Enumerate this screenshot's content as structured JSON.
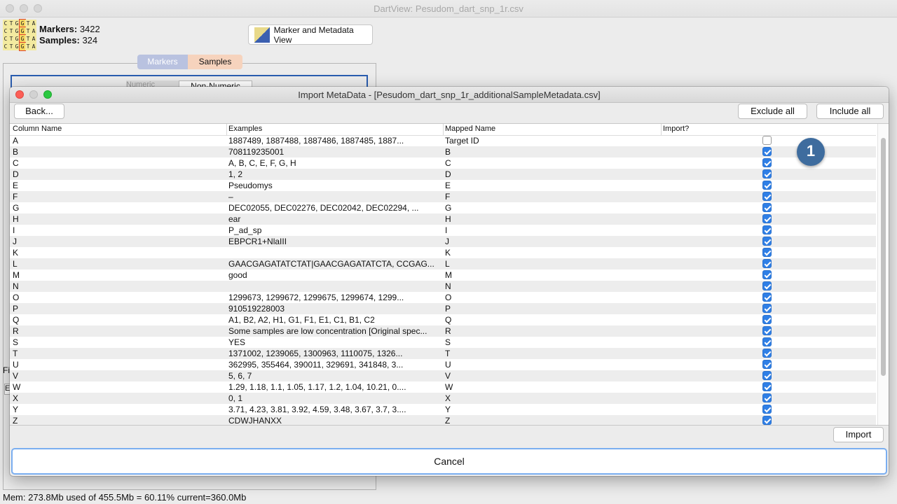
{
  "main_window": {
    "title": "DartView: Pesudom_dart_snp_1r.csv",
    "logo_letters": [
      "C",
      "T",
      "G",
      "G",
      "T",
      "A",
      "C",
      "T",
      "G",
      "G",
      "T",
      "A",
      "C",
      "T",
      "G",
      "G",
      "T",
      "A",
      "C",
      "T",
      "G",
      "G",
      "T",
      "A"
    ],
    "markers_label": "Markers:",
    "markers_value": "3422",
    "samples_label": "Samples:",
    "samples_value": "324",
    "marker_metadata_button": "Marker and Metadata View",
    "tabs": [
      "Markers",
      "Samples"
    ],
    "subtabs": [
      "Numeric",
      "Non-Numeric"
    ],
    "status": "Mem: 273.8Mb used of 455.5Mb = 60.11% current=360.0Mb",
    "partial_label_1": "Fi",
    "partial_label_2": "E"
  },
  "dialog": {
    "title": "Import MetaData - [Pesudom_dart_snp_1r_additionalSampleMetadata.csv]",
    "back_button": "Back...",
    "exclude_all_button": "Exclude all",
    "include_all_button": "Include all",
    "import_button": "Import",
    "cancel_button": "Cancel",
    "badge": "1",
    "columns": [
      "Column Name",
      "Examples",
      "Mapped Name",
      "Import?"
    ],
    "rows": [
      {
        "name": "A",
        "examples": "1887489, 1887488, 1887486, 1887485, 1887...",
        "mapped": "Target ID",
        "import": false
      },
      {
        "name": "B",
        "examples": "708119235001",
        "mapped": "B",
        "import": true
      },
      {
        "name": "C",
        "examples": "A, B, C, E, F, G, H",
        "mapped": "C",
        "import": true
      },
      {
        "name": "D",
        "examples": "1, 2",
        "mapped": "D",
        "import": true
      },
      {
        "name": "E",
        "examples": "Pseudomys",
        "mapped": "E",
        "import": true
      },
      {
        "name": "F",
        "examples": "–",
        "mapped": "F",
        "import": true
      },
      {
        "name": "G",
        "examples": "DEC02055, DEC02276, DEC02042, DEC02294, ...",
        "mapped": "G",
        "import": true
      },
      {
        "name": "H",
        "examples": "ear",
        "mapped": "H",
        "import": true
      },
      {
        "name": "I",
        "examples": "P_ad_sp",
        "mapped": "I",
        "import": true
      },
      {
        "name": "J",
        "examples": "EBPCR1+NlaIII",
        "mapped": "J",
        "import": true
      },
      {
        "name": "K",
        "examples": "",
        "mapped": "K",
        "import": true
      },
      {
        "name": "L",
        "examples": "GAACGAGATATCTAT|GAACGAGATATCTA, CCGAG...",
        "mapped": "L",
        "import": true
      },
      {
        "name": "M",
        "examples": "good",
        "mapped": "M",
        "import": true
      },
      {
        "name": "N",
        "examples": "",
        "mapped": "N",
        "import": true
      },
      {
        "name": "O",
        "examples": "1299673, 1299672, 1299675, 1299674, 1299...",
        "mapped": "O",
        "import": true
      },
      {
        "name": "P",
        "examples": "910519228003",
        "mapped": "P",
        "import": true
      },
      {
        "name": "Q",
        "examples": "A1, B2, A2, H1, G1, F1, E1, C1, B1, C2",
        "mapped": "Q",
        "import": true
      },
      {
        "name": "R",
        "examples": "Some samples are low concentration [Original spec...",
        "mapped": "R",
        "import": true
      },
      {
        "name": "S",
        "examples": "YES",
        "mapped": "S",
        "import": true
      },
      {
        "name": "T",
        "examples": "1371002, 1239065, 1300963, 1110075, 1326...",
        "mapped": "T",
        "import": true
      },
      {
        "name": "U",
        "examples": "362995, 355464, 390011, 329691, 341848, 3...",
        "mapped": "U",
        "import": true
      },
      {
        "name": "V",
        "examples": "5, 6, 7",
        "mapped": "V",
        "import": true
      },
      {
        "name": "W",
        "examples": "1.29, 1.18, 1.1, 1.05, 1.17, 1.2, 1.04, 10.21, 0....",
        "mapped": "W",
        "import": true
      },
      {
        "name": "X",
        "examples": "0, 1",
        "mapped": "X",
        "import": true
      },
      {
        "name": "Y",
        "examples": "3.71, 4.23, 3.81, 3.92, 4.59, 3.48, 3.67, 3.7, 3....",
        "mapped": "Y",
        "import": true
      },
      {
        "name": "Z",
        "examples": "CDWJHANXX",
        "mapped": "Z",
        "import": true
      }
    ]
  }
}
